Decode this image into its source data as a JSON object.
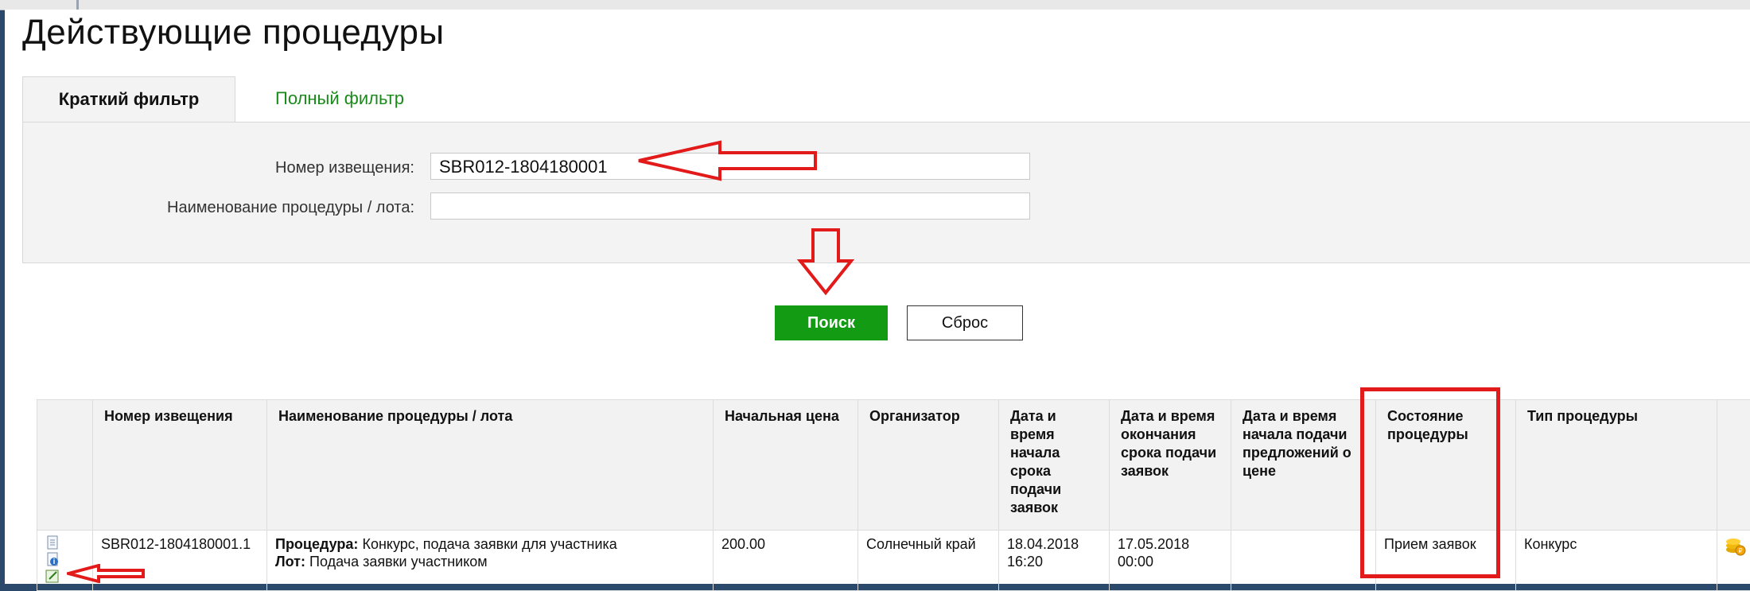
{
  "page_title": "Действующие процедуры",
  "tabs": [
    {
      "label": "Краткий фильтр",
      "active": true
    },
    {
      "label": "Полный фильтр",
      "active": false
    }
  ],
  "filter": {
    "notice_label": "Номер извещения:",
    "notice_value": "SBR012-1804180001",
    "name_label": "Наименование процедуры / лота:",
    "name_value": ""
  },
  "buttons": {
    "search": "Поиск",
    "reset": "Сброс"
  },
  "table": {
    "columns": [
      "",
      "Номер извещения",
      "Наименование процедуры / лота",
      "Начальная цена",
      "Организатор",
      "Дата и время начала срока подачи заявок",
      "Дата и время окончания срока подачи заявок",
      "Дата и время начала подачи предложений о цене",
      "Состояние процедуры",
      "Тип процедуры",
      ""
    ],
    "rows": [
      {
        "notice_number": "SBR012-1804180001.1",
        "procedure_label": "Процедура:",
        "procedure_value": "Конкурс, подача заявки для участника",
        "lot_label": "Лот:",
        "lot_value": "Подача заявки участником",
        "start_price": "200.00",
        "organizer": "Солнечный край",
        "apps_start": "18.04.2018 16:20",
        "apps_end": "17.05.2018 00:00",
        "price_offers_start": "",
        "status": "Прием заявок",
        "procedure_type": "Конкурс"
      }
    ]
  },
  "colors": {
    "accent_green": "#139c13",
    "annotation_red": "#e21a1a"
  }
}
